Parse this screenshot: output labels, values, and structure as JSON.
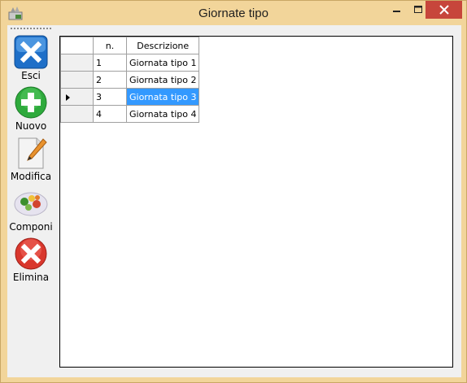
{
  "window": {
    "title": "Giornate tipo"
  },
  "toolbar": {
    "items": [
      {
        "label": "Esci",
        "icon": "exit-icon"
      },
      {
        "label": "Nuovo",
        "icon": "plus-icon"
      },
      {
        "label": "Modifica",
        "icon": "edit-icon"
      },
      {
        "label": "Componi",
        "icon": "food-plate-icon"
      },
      {
        "label": "Elimina",
        "icon": "delete-icon"
      }
    ]
  },
  "grid": {
    "columns": [
      "n.",
      "Descrizione"
    ],
    "rows": [
      {
        "n": "1",
        "descrizione": "Giornata tipo 1"
      },
      {
        "n": "2",
        "descrizione": "Giornata tipo 2"
      },
      {
        "n": "3",
        "descrizione": "Giornata tipo 3"
      },
      {
        "n": "4",
        "descrizione": "Giornata tipo 4"
      }
    ],
    "selected_row": 3
  },
  "colors": {
    "window_frame": "#f2d59a",
    "selection": "#3399ff",
    "close_button": "#c7463b"
  }
}
